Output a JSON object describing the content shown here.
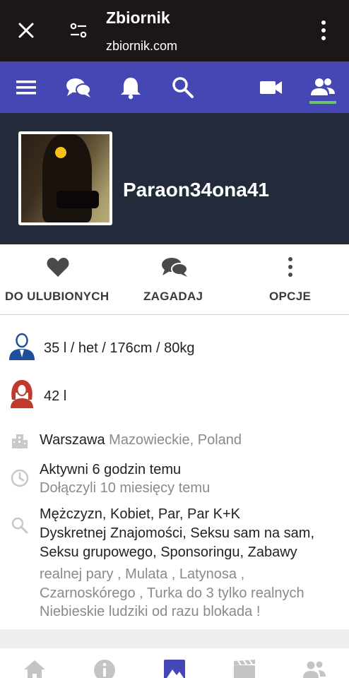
{
  "browser": {
    "title": "Zbiornik",
    "url": "zbiornik.com"
  },
  "nav": {
    "items": [
      "menu-icon",
      "chat-icon",
      "bell-icon",
      "search-icon",
      "video-icon",
      "people-icon"
    ],
    "active": "people-icon",
    "accent_color": "#4547b4",
    "active_underline_color": "#6cc46c"
  },
  "profile": {
    "username": "Paraon34ona41"
  },
  "actions": {
    "favorite_label": "DO ULUBIONYCH",
    "ask_label": "ZAGADAJ",
    "options_label": "OPCJE"
  },
  "info": {
    "male_stats": "35 l / het / 176cm / 80kg",
    "female_stats": "42 l",
    "city": "Warszawa",
    "region": "Mazowieckie, Poland",
    "active": "Aktywni 6 godzin temu",
    "joined": "Dołączyli 10 miesięcy temu",
    "seeking_line1": "Mężczyzn, Kobiet, Par, Par K+K",
    "seeking_line2": "Dyskretnej Znajomości, Seksu sam na sam,",
    "seeking_line3": "Seksu grupowego, Sponsoringu, Zabawy",
    "desc_line1": "realnej pary , Mulata , Latynosa ,",
    "desc_line2": "Czarnoskórego , Turka do 3 tylko realnych",
    "desc_line3": "Niebieskie ludziki od razu blokada !"
  },
  "tabs": [
    "home-icon",
    "info-icon",
    "photo-icon",
    "film-icon",
    "people-icon"
  ]
}
